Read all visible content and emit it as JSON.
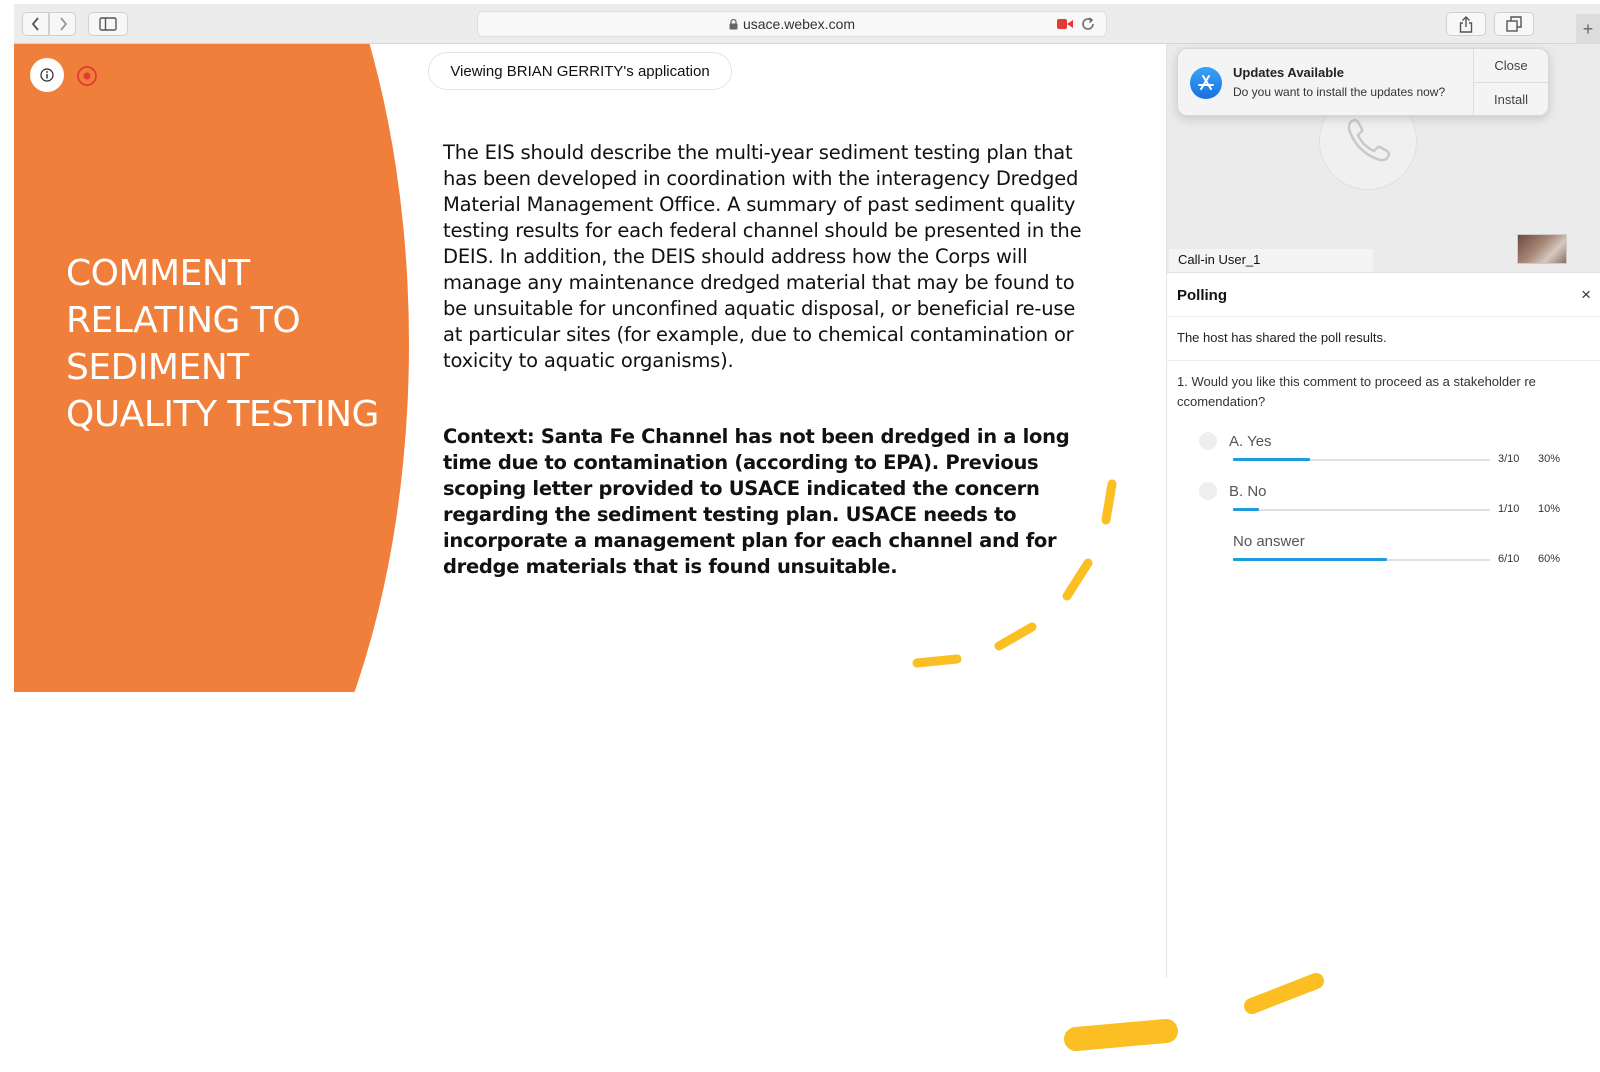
{
  "browser": {
    "url": "usace.webex.com"
  },
  "slide": {
    "viewing_label": "Viewing BRIAN GERRITY's application",
    "title_lines": [
      "COMMENT",
      "RELATING TO",
      "SEDIMENT",
      "QUALITY TESTING"
    ],
    "paragraph": "The EIS should describe the multi-year sediment testing plan that has been developed in coordination with the interagency Dredged Material Management Office. A summary of past sediment quality testing results for each federal channel should be presented in the DEIS. In addition, the DEIS should address how the Corps will manage any maintenance dredged material that may be found to be unsuitable for unconfined aquatic disposal, or beneficial re-use at particular sites (for example, due to chemical contamination or toxicity to aquatic organisms).",
    "context": "Context: Santa Fe Channel has not been dredged in a long time due to contamination (according to EPA). Previous scoping letter provided to USACE indicated the concern regarding the sediment testing plan. USACE needs to incorporate a management plan for each channel and for dredge materials that is found unsuitable.",
    "accent_color": "#ef7f3a",
    "annotation_color": "#fbbf24"
  },
  "notification": {
    "title": "Updates Available",
    "body": "Do you want to install the updates now?",
    "close_label": "Close",
    "install_label": "Install"
  },
  "video": {
    "participant_label": "Call-in User_1"
  },
  "polling": {
    "title": "Polling",
    "close_glyph": "×",
    "shared_message": "The host has shared the poll results.",
    "question": "1. Would you like this comment to proceed as a stakeholder re ccomendation?",
    "options": [
      {
        "label": "A. Yes",
        "count": "3/10",
        "percent": "30%",
        "fraction": 0.3
      },
      {
        "label": "B. No",
        "count": "1/10",
        "percent": "10%",
        "fraction": 0.1
      },
      {
        "label": "No answer",
        "count": "6/10",
        "percent": "60%",
        "fraction": 0.6
      }
    ],
    "bar_color": "#1f9be0"
  }
}
